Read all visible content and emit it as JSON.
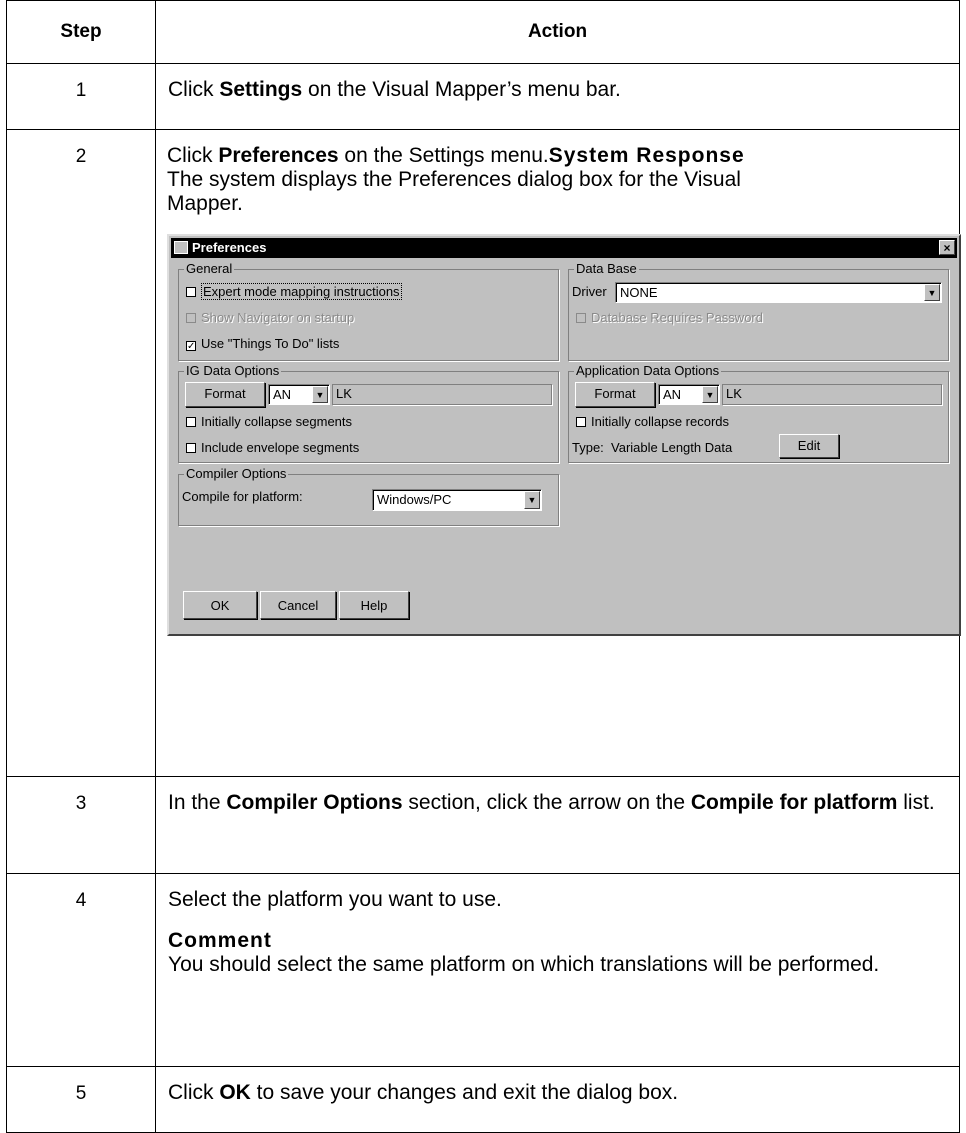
{
  "table": {
    "headers": {
      "step": "Step",
      "action": "Action"
    },
    "rows": [
      {
        "step": "1",
        "pre": "Click ",
        "bold": "Settings",
        "post": " on the Visual Mapper’s menu bar."
      },
      {
        "step": "2",
        "pre": "Click ",
        "bold": "Preferences",
        "post": " on the Settings menu.",
        "response_title": "System Response",
        "response_text": "The system displays the Preferences dialog box for the Visual Mapper."
      },
      {
        "step": "3",
        "p1": "In the ",
        "b1": "Compiler Options",
        "p2": " section, click the arrow on the ",
        "b2": "Compile for platform",
        "p3": " list."
      },
      {
        "step": "4",
        "text": "Select the platform you want to use.",
        "comment_title": "Comment",
        "comment_text": "You should select the same platform on which translations will be performed."
      },
      {
        "step": "5",
        "pre": "Click ",
        "bold": "OK",
        "post": " to save your changes and exit the dialog box."
      }
    ]
  },
  "dialog": {
    "title": "Preferences",
    "close": "×",
    "general": {
      "legend": "General",
      "expert": "Expert mode mapping instructions",
      "navigator": "Show Navigator on startup",
      "things": "Use \"Things To Do\" lists",
      "things_checked": "✓"
    },
    "database": {
      "legend": "Data Base",
      "driver_label": "Driver",
      "driver_value": "NONE",
      "password": "Database Requires Password"
    },
    "ig": {
      "legend": "IG Data Options",
      "format": "Format",
      "type_value": "AN",
      "lk": "LK",
      "collapse": "Initially collapse segments",
      "envelope": "Include envelope segments"
    },
    "app": {
      "legend": "Application Data Options",
      "format": "Format",
      "type_value": "AN",
      "lk": "LK",
      "collapse": "Initially collapse records",
      "type_text": "Type:  Variable Length Data",
      "edit": "Edit"
    },
    "compiler": {
      "legend": "Compiler Options",
      "label": "Compile for platform:",
      "value": "Windows/PC"
    },
    "buttons": {
      "ok": "OK",
      "cancel": "Cancel",
      "help": "Help"
    },
    "arrow": "▼"
  }
}
